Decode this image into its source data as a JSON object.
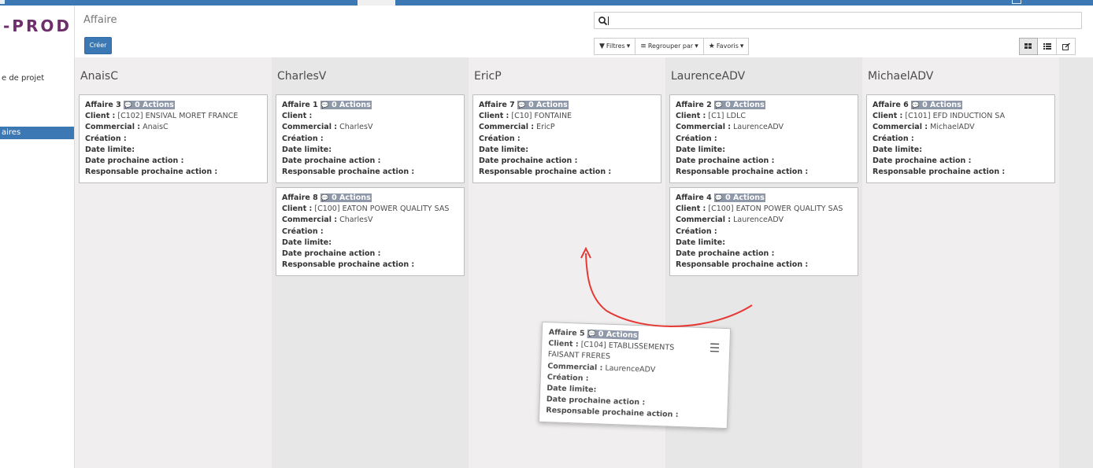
{
  "sidebar": {
    "logo": "-PROD",
    "items": [
      {
        "label": "e de projet"
      },
      {
        "label": "aires"
      }
    ]
  },
  "control": {
    "breadcrumb": "Affaire",
    "create_label": "Créer",
    "search": {
      "value": "",
      "placeholder": ""
    },
    "filters_label": "Filtres",
    "groupby_label": "Regrouper par",
    "favorites_label": "Favoris"
  },
  "kanban": {
    "columns": [
      {
        "title": "AnaisC"
      },
      {
        "title": "CharlesV"
      },
      {
        "title": "EricP"
      },
      {
        "title": "LaurenceADV"
      },
      {
        "title": "MichaelADV"
      }
    ],
    "labels": {
      "client": "Client :",
      "commercial": "Commercial :",
      "creation": "Création :",
      "date_limite": "Date limite:",
      "date_prochaine": "Date prochaine action :",
      "responsable": "Responsable prochaine action :",
      "actions": "0 Actions"
    },
    "cards": {
      "a3": {
        "name": "Affaire 3",
        "client": "[C102] ENSIVAL MORET FRANCE",
        "commercial": "AnaisC"
      },
      "a1": {
        "name": "Affaire 1",
        "client": "",
        "commercial": "CharlesV"
      },
      "a8": {
        "name": "Affaire 8",
        "client": "[C100] EATON POWER QUALITY SAS",
        "commercial": "CharlesV"
      },
      "a7": {
        "name": "Affaire 7",
        "client": "[C10] FONTAINE",
        "commercial": "EricP"
      },
      "a2": {
        "name": "Affaire 2",
        "client": "[C1] LDLC",
        "commercial": "LaurenceADV"
      },
      "a4": {
        "name": "Affaire 4",
        "client": "[C100] EATON POWER QUALITY SAS",
        "commercial": "LaurenceADV"
      },
      "a6": {
        "name": "Affaire 6",
        "client": "[C101] EFD INDUCTION SA",
        "commercial": "MichaelADV"
      },
      "a5": {
        "name": "Affaire 5",
        "client": "[C104] ETABLISSEMENTS FAISANT FRERES",
        "commercial": "LaurenceADV"
      }
    }
  },
  "colors": {
    "brand": "#3c78b4",
    "logo": "#6d2f6b",
    "badge": "#8f98a8",
    "arrow": "#e53935"
  },
  "icons": [
    "search-icon",
    "filter-icon",
    "list-icon",
    "star-icon",
    "chat-icon",
    "kanban-view-icon",
    "list-view-icon",
    "form-view-icon",
    "drag-handle-icon"
  ]
}
